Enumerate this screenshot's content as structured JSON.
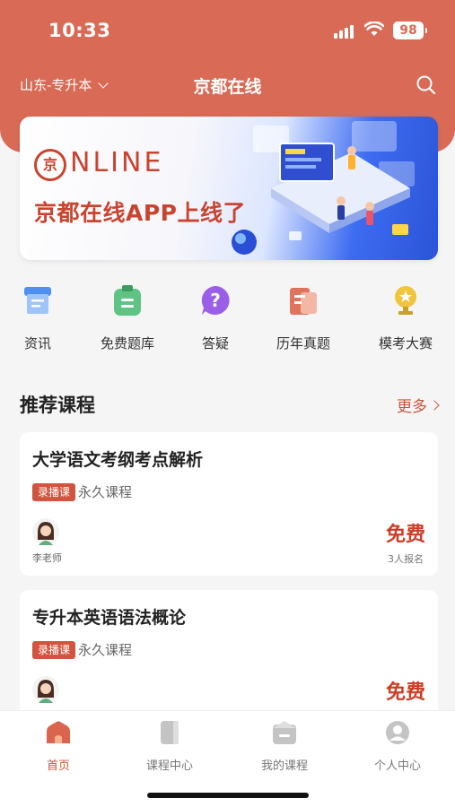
{
  "status": {
    "time": "10:33",
    "battery": "98"
  },
  "nav": {
    "region": "山东-专升本",
    "title": "京都在线"
  },
  "banner": {
    "logo_char": "京",
    "online_text": "NLINE",
    "headline": "京都在线APP上线了"
  },
  "quick_entries": [
    {
      "label": "资讯",
      "icon": "news-icon"
    },
    {
      "label": "免费题库",
      "icon": "question-bank-icon"
    },
    {
      "label": "答疑",
      "icon": "qa-icon"
    },
    {
      "label": "历年真题",
      "icon": "past-papers-icon"
    },
    {
      "label": "模考大赛",
      "icon": "trophy-icon"
    }
  ],
  "recommended": {
    "title": "推荐课程",
    "more": "更多",
    "courses": [
      {
        "title": "大学语文考纲考点解析",
        "tag": "录播课",
        "validity": "永久课程",
        "teacher": "李老师",
        "price": "免费",
        "enrolled": "3人报名"
      },
      {
        "title": "专升本英语语法概论",
        "tag": "录播课",
        "validity": "永久课程",
        "teacher": "",
        "price": "免费",
        "enrolled": ""
      }
    ]
  },
  "tabbar": [
    {
      "label": "首页",
      "active": true
    },
    {
      "label": "课程中心",
      "active": false
    },
    {
      "label": "我的课程",
      "active": false
    },
    {
      "label": "个人中心",
      "active": false
    }
  ],
  "colors": {
    "brand": "#d96a55",
    "accent_red": "#cc3d26",
    "tag_red": "#d0543e"
  }
}
